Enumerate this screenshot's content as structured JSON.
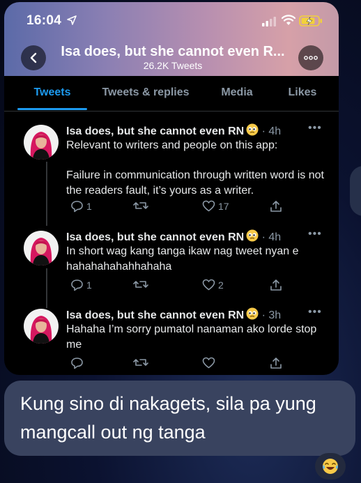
{
  "status_bar": {
    "time": "16:04"
  },
  "profile_header": {
    "title": "Isa does, but she cannot even R...",
    "tweet_count": "26.2K Tweets"
  },
  "tabs": [
    {
      "label": "Tweets",
      "active": true
    },
    {
      "label": "Tweets & replies",
      "active": false
    },
    {
      "label": "Media",
      "active": false
    },
    {
      "label": "Likes",
      "active": false
    }
  ],
  "tweets": [
    {
      "author": "Isa does, but she cannot even RN",
      "author_emoji": "eyes-emoji",
      "time": "· 4h",
      "text": "Relevant to writers and people on this app:\n\nFailure in communication through written word is not the readers fault, it’s yours as a writer.",
      "replies": "1",
      "retweets": "",
      "likes": "17"
    },
    {
      "author": "Isa does, but she cannot even RN",
      "author_emoji": "eyes-emoji",
      "time": "· 4h",
      "text": "In short wag kang tanga ikaw nag tweet nyan e hahahahahahhahaha",
      "replies": "1",
      "retweets": "",
      "likes": "2"
    },
    {
      "author": "Isa does, but she cannot even RN",
      "author_emoji": "eyes-emoji",
      "time": "· 3h",
      "text": "Hahaha I’m sorry pumatol nanaman ako lorde stop me",
      "replies": "",
      "retweets": "",
      "likes": ""
    }
  ],
  "chat_message": {
    "text": "Kung sino di nakagets, sila pa yung mangcall out ng tanga",
    "reaction": "tears-of-joy-emoji"
  },
  "colors": {
    "accent": "#1d9bf0",
    "tweet_bg": "#000000",
    "message_bubble": "#39435f",
    "muted_text": "#8b98a5"
  }
}
